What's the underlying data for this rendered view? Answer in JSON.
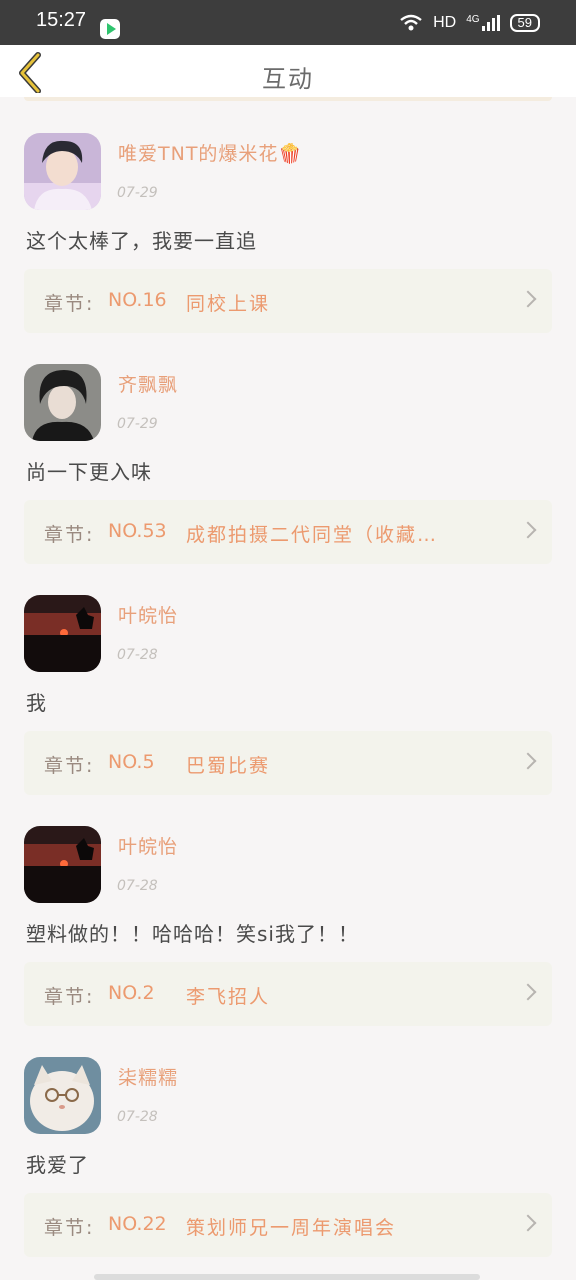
{
  "status": {
    "time": "15:27",
    "network": "HD",
    "signal": "4G",
    "battery": "59"
  },
  "nav": {
    "title": "互动"
  },
  "items": [
    {
      "user": "唯爱TNT的爆米花🍿",
      "date": "07-29",
      "comment": "这个太棒了，我要一直追",
      "chapter_label": "章节:",
      "chapter_no": "NO.16",
      "chapter_title": "同校上课"
    },
    {
      "user": "齐飘飘",
      "date": "07-29",
      "comment": "尚一下更入味",
      "chapter_label": "章节:",
      "chapter_no": "NO.53",
      "chapter_title": "成都拍摄二代同堂（收藏…"
    },
    {
      "user": "叶皖怡",
      "date": "07-28",
      "comment": "我",
      "chapter_label": "章节:",
      "chapter_no": "NO.5",
      "chapter_title": "巴蜀比赛"
    },
    {
      "user": "叶皖怡",
      "date": "07-28",
      "comment": "塑料做的！！哈哈哈！笑si我了！！",
      "chapter_label": "章节:",
      "chapter_no": "NO.2",
      "chapter_title": "李飞招人"
    },
    {
      "user": "柒糯糯",
      "date": "07-28",
      "comment": "我爱了",
      "chapter_label": "章节:",
      "chapter_no": "NO.22",
      "chapter_title": "策划师兄一周年演唱会"
    }
  ]
}
